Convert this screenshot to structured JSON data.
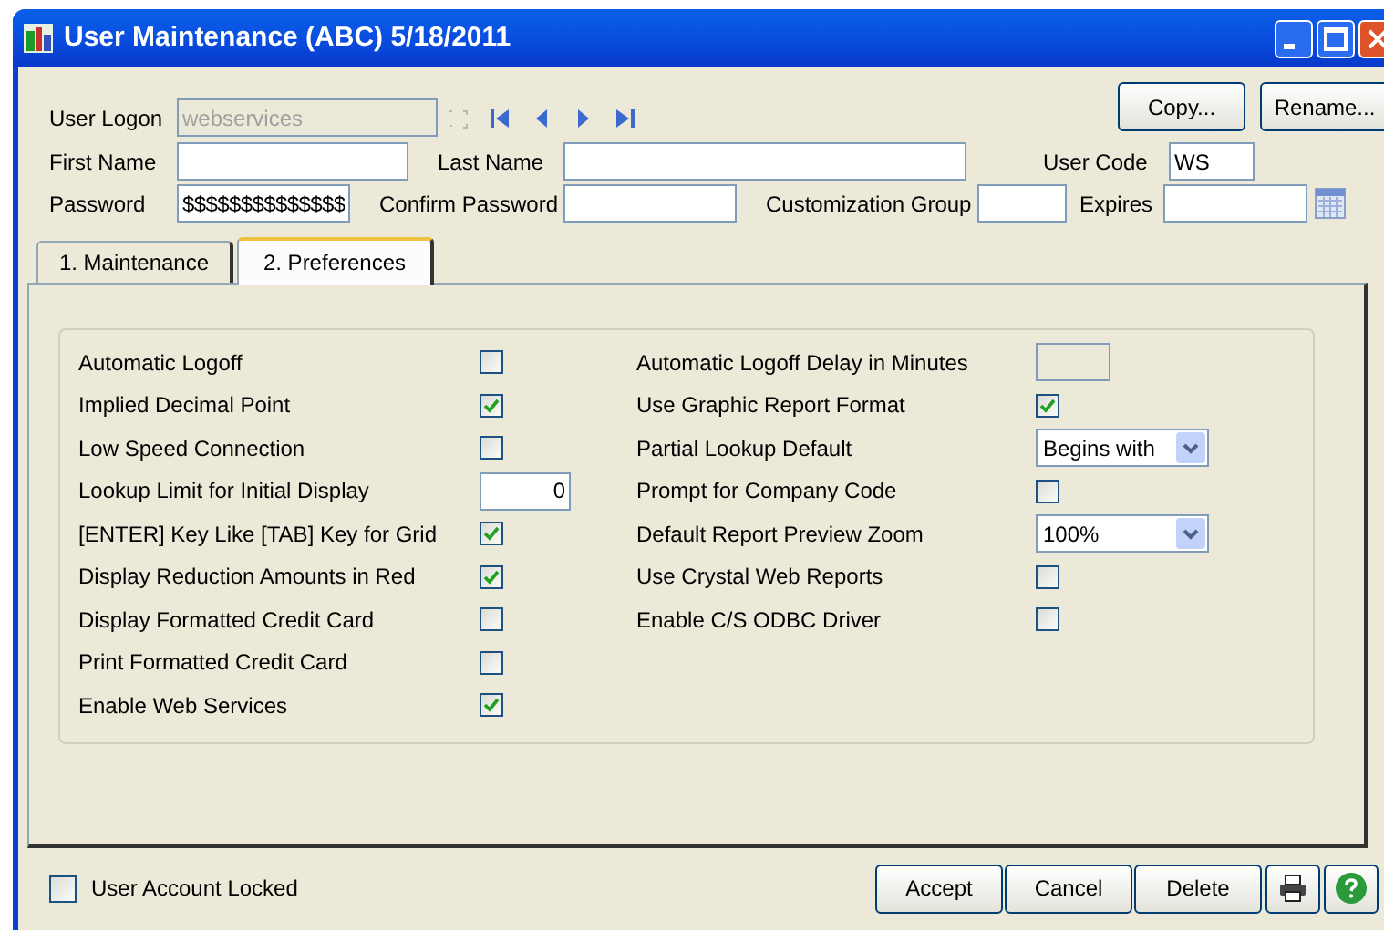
{
  "window": {
    "title": "User Maintenance (ABC) 5/18/2011"
  },
  "header": {
    "user_logon": {
      "label": "User Logon",
      "value": "webservices",
      "disabled": true
    },
    "first_name": {
      "label": "First Name"
    },
    "last_name": {
      "label": "Last Name"
    },
    "user_code": {
      "label": "User Code",
      "value": "WS"
    },
    "password": {
      "label": "Password",
      "value": "$$$$$$$$$$$$$$"
    },
    "confirm_password": {
      "label": "Confirm Password"
    },
    "customization_group": {
      "label": "Customization Group"
    },
    "expires": {
      "label": "Expires"
    },
    "buttons": [
      "Copy...",
      "Rename..."
    ]
  },
  "tabs": [
    {
      "label": "1. Maintenance",
      "selected": false
    },
    {
      "label": "2. Preferences",
      "selected": true
    }
  ],
  "preferences": {
    "left": [
      {
        "label": "Automatic Logoff",
        "kind": "checkbox",
        "checked": false
      },
      {
        "label": "Implied Decimal Point",
        "kind": "checkbox",
        "checked": true
      },
      {
        "label": "Low Speed Connection",
        "kind": "checkbox",
        "checked": false
      },
      {
        "label": "Lookup Limit for Initial Display",
        "kind": "number",
        "value": "0"
      },
      {
        "label": "[ENTER] Key Like [TAB] Key for Grid",
        "kind": "checkbox",
        "checked": true
      },
      {
        "label": "Display Reduction Amounts in Red",
        "kind": "checkbox",
        "checked": true
      },
      {
        "label": "Display Formatted Credit Card",
        "kind": "checkbox",
        "checked": false
      },
      {
        "label": "Print Formatted Credit Card",
        "kind": "checkbox",
        "checked": false
      },
      {
        "label": "Enable Web Services",
        "kind": "checkbox",
        "checked": true
      }
    ],
    "right": [
      {
        "label": "Automatic Logoff Delay in Minutes",
        "kind": "field",
        "disabled": true
      },
      {
        "label": "Use Graphic Report Format",
        "kind": "checkbox",
        "checked": true
      },
      {
        "label": "Partial Lookup Default",
        "kind": "dropdown",
        "value": "Begins with"
      },
      {
        "label": "Prompt for Company Code",
        "kind": "checkbox",
        "checked": false
      },
      {
        "label": "Default Report Preview Zoom",
        "kind": "dropdown",
        "value": "100%"
      },
      {
        "label": "Use Crystal Web Reports",
        "kind": "checkbox",
        "checked": false
      },
      {
        "label": "Enable C/S ODBC Driver",
        "kind": "checkbox",
        "checked": false
      }
    ]
  },
  "footer": {
    "user_account_locked": {
      "label": "User Account Locked",
      "checked": false
    },
    "buttons": [
      "Accept",
      "Cancel",
      "Delete"
    ]
  }
}
